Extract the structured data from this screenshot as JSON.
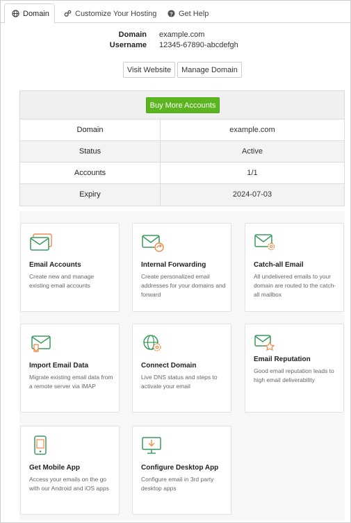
{
  "tabs": [
    {
      "label": "Domain",
      "icon": "globe-icon"
    },
    {
      "label": "Customize Your Hosting",
      "icon": "cogs-icon"
    },
    {
      "label": "Get Help",
      "icon": "help-circle-icon"
    }
  ],
  "info": {
    "domain_label": "Domain",
    "domain_value": "example.com",
    "username_label": "Username",
    "username_value": "12345-67890-abcdefgh"
  },
  "buttons": {
    "visit_website": "Visit Website",
    "manage_domain": "Manage Domain",
    "buy_more": "Buy More Accounts"
  },
  "details": [
    {
      "label": "Domain",
      "value": "example.com"
    },
    {
      "label": "Status",
      "value": "Active"
    },
    {
      "label": "Accounts",
      "value": "1/1"
    },
    {
      "label": "Expiry",
      "value": "2024-07-03"
    }
  ],
  "cards": [
    {
      "title": "Email Accounts",
      "desc": "Create new and manage existing email accounts",
      "icon": "email-accounts-icon"
    },
    {
      "title": "Internal Forwarding",
      "desc": "Create personalized email addresses for your domains and forward",
      "icon": "email-forward-icon"
    },
    {
      "title": "Catch-all Email",
      "desc": "All undelivered emails to your domain are routed to the catch-all mailbox",
      "icon": "catch-all-icon"
    },
    {
      "title": "Import Email Data",
      "desc": "Migrate existing email data from a remote server via IMAP",
      "icon": "import-email-icon"
    },
    {
      "title": "Connect Domain",
      "desc": "Live DNS status and steps to activate your email",
      "icon": "connect-domain-icon"
    },
    {
      "title": "Email Reputation",
      "desc": "Good email reputation leads to high email deliverability",
      "icon": "email-reputation-icon"
    },
    {
      "title": "Get Mobile App",
      "desc": "Access your emails on the go with our Android and iOS apps",
      "icon": "mobile-app-icon"
    },
    {
      "title": "Configure Desktop App",
      "desc": "Configure email in 3rd party desktop apps",
      "icon": "desktop-app-icon"
    }
  ],
  "colors": {
    "accent_green": "#5bb51f",
    "icon_green": "#3a9a5b",
    "icon_orange": "#f08a4b"
  }
}
